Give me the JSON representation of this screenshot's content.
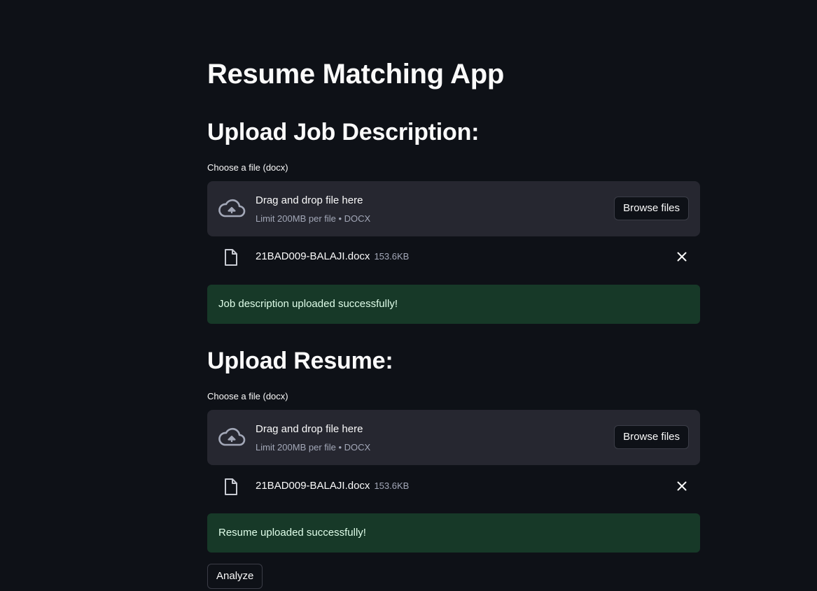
{
  "app": {
    "title": "Resume Matching App"
  },
  "job_section": {
    "heading": "Upload Job Description:",
    "uploader_label": "Choose a file (docx)",
    "dropzone_title": "Drag and drop file here",
    "dropzone_limit": "Limit 200MB per file • DOCX",
    "browse_label": "Browse files",
    "file_name": "21BAD009-BALAJI.docx",
    "file_size": "153.6KB",
    "success_message": "Job description uploaded successfully!"
  },
  "resume_section": {
    "heading": "Upload Resume:",
    "uploader_label": "Choose a file (docx)",
    "dropzone_title": "Drag and drop file here",
    "dropzone_limit": "Limit 200MB per file • DOCX",
    "browse_label": "Browse files",
    "file_name": "21BAD009-BALAJI.docx",
    "file_size": "153.6KB",
    "success_message": "Resume uploaded successfully!"
  },
  "actions": {
    "analyze_label": "Analyze"
  },
  "icons": {
    "upload": "cloud-upload-icon",
    "file": "file-icon",
    "remove": "close-icon"
  },
  "colors": {
    "background": "#0e1117",
    "dropzone": "#262730",
    "success_bg": "#173928",
    "success_text": "#dffde9"
  }
}
